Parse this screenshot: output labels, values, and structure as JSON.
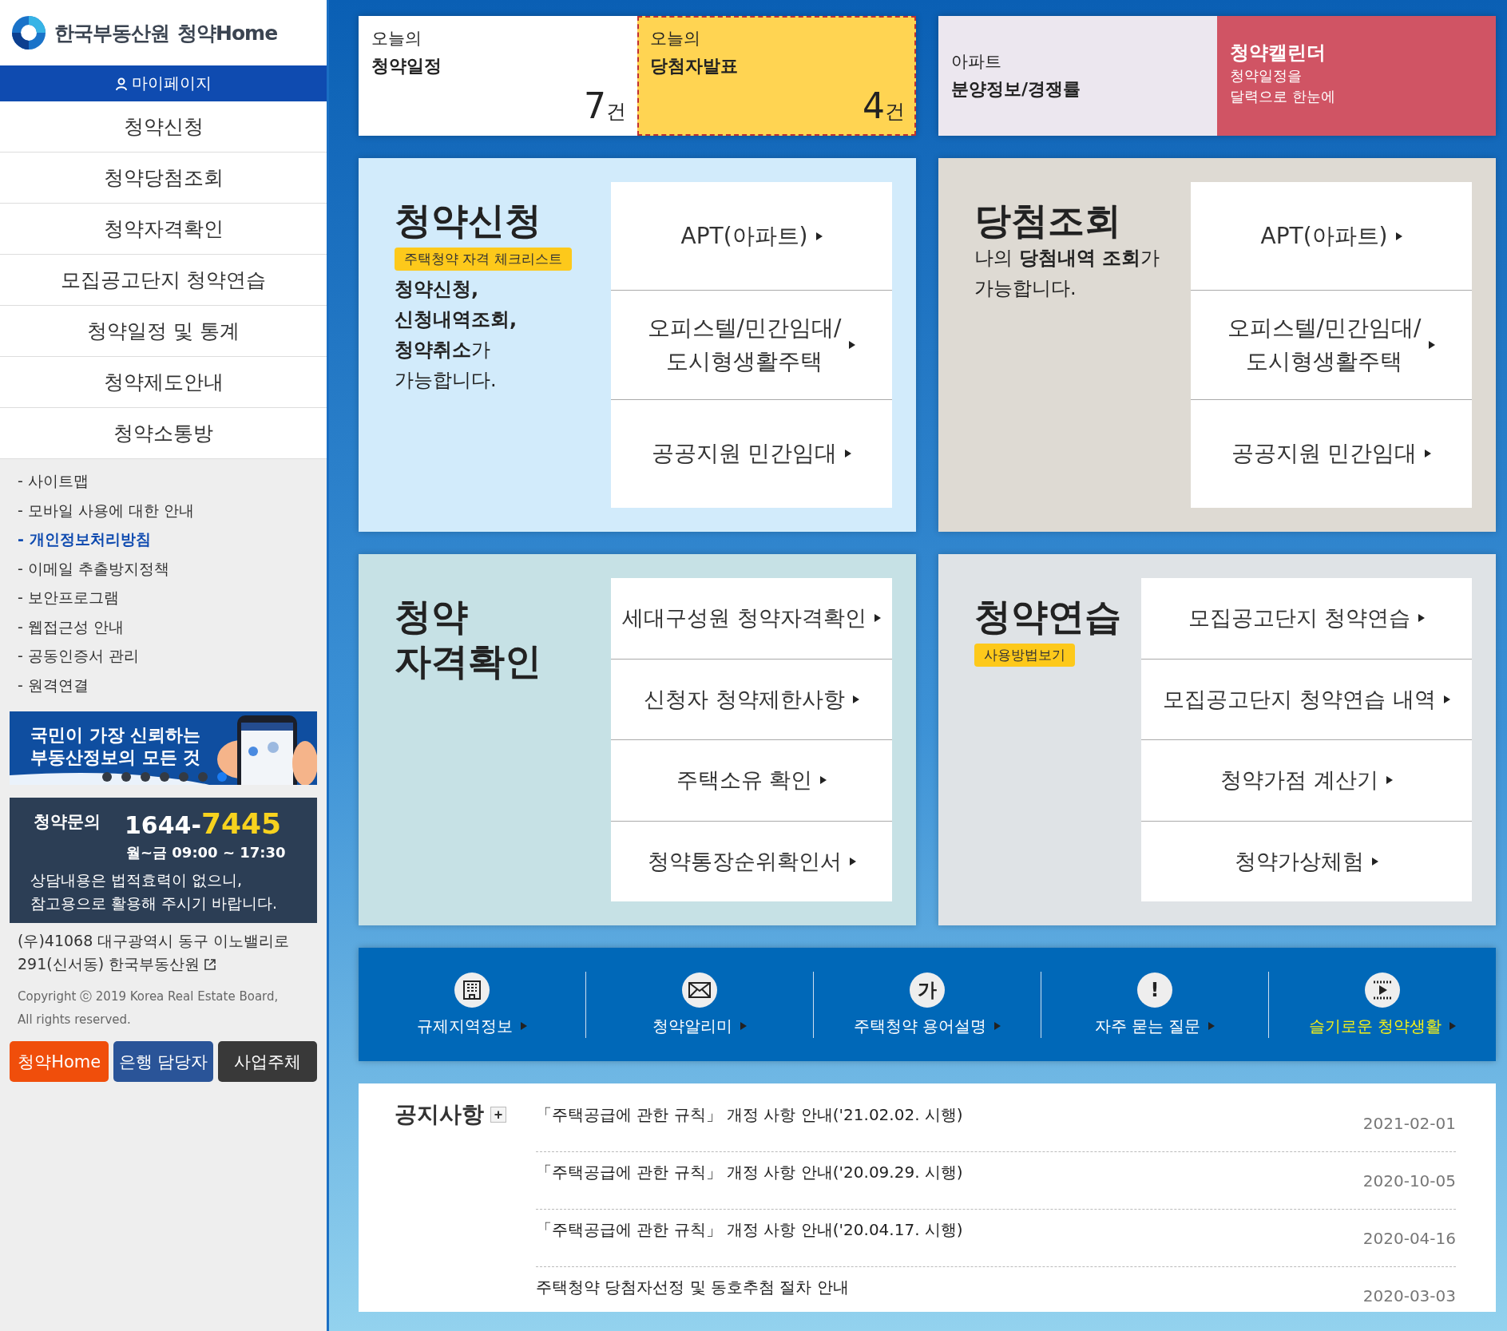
{
  "logo": {
    "org": "한국부동산원",
    "service": "청약Home"
  },
  "mypage": "마이페이지",
  "menu": [
    "청약신청",
    "청약당첨조회",
    "청약자격확인",
    "모집공고단지 청약연습",
    "청약일정 및 통계",
    "청약제도안내",
    "청약소통방"
  ],
  "footer_links": [
    {
      "label": "- 사이트맵",
      "highlighted": false
    },
    {
      "label": "- 모바일 사용에 대한 안내",
      "highlighted": false
    },
    {
      "label": "- 개인정보처리방침",
      "highlighted": true
    },
    {
      "label": "- 이메일 추출방지정책",
      "highlighted": false
    },
    {
      "label": "- 보안프로그램",
      "highlighted": false
    },
    {
      "label": "- 웹접근성 안내",
      "highlighted": false
    },
    {
      "label": "- 공동인증서 관리",
      "highlighted": false
    },
    {
      "label": "- 원격연결",
      "highlighted": false
    }
  ],
  "banner": {
    "lines": [
      "국민이 가장 신뢰하는",
      "부동산정보의 모든 것"
    ],
    "slides": [
      {
        "selected": false
      },
      {
        "selected": false
      },
      {
        "selected": false
      },
      {
        "selected": false
      },
      {
        "selected": false
      },
      {
        "selected": false
      },
      {
        "selected": true
      }
    ]
  },
  "inquiry": {
    "label": "청약문의",
    "phone_prefix": "1644-",
    "phone_suffix": "7445",
    "hours": "월~금 09:00 ~ 17:30",
    "note": [
      "상담내용은 법적효력이 없으니,",
      "참고용으로 활용해 주시기 바랍니다."
    ]
  },
  "address": [
    "(우)41068 대구광역시 동구 이노밸리로",
    "291(신서동) 한국부동산원"
  ],
  "copyright": [
    "Copyright ⓒ 2019 Korea Real Estate Board,",
    "All rights reserved."
  ],
  "site_buttons": [
    {
      "label": "청약Home",
      "color": "#f04e0b"
    },
    {
      "label": "은행 담당자",
      "color": "#2a5498"
    },
    {
      "label": "사업주체",
      "color": "#393939"
    }
  ],
  "top_tiles": [
    {
      "kicker": "오늘의",
      "title": "청약일정",
      "count": "7",
      "unit": "건",
      "color": "#ffffff",
      "focused": false,
      "kind": "count"
    },
    {
      "kicker": "오늘의",
      "title": "당첨자발표",
      "count": "4",
      "unit": "건",
      "color": "#ffd452",
      "focused": true,
      "kind": "count"
    },
    {
      "kicker": "아파트",
      "title": "분양정보/경쟁률",
      "color": "#ece7ef",
      "focused": false,
      "kind": "plain"
    },
    {
      "title": "청약캘린더",
      "lines": [
        "청약일정을",
        "달력으로 한눈에"
      ],
      "color": "#d05464",
      "focused": false,
      "kind": "promo"
    }
  ],
  "cards": [
    {
      "title": [
        "청약신청"
      ],
      "tag": "주택청약 자격 체크리스트",
      "description": [
        "**청약신청,**",
        "**신청내역조회,**",
        "**청약취소**가",
        "가능합니다."
      ],
      "color": "#d2ebfb",
      "links": [
        [
          "APT(아파트)"
        ],
        [
          "오피스텔/민간임대/",
          "도시형생활주택"
        ],
        [
          "공공지원 민간임대"
        ]
      ]
    },
    {
      "title": [
        "당첨조회"
      ],
      "description": [
        "나의 **당첨내역 조회**가",
        "가능합니다."
      ],
      "color": "#dedad3",
      "links": [
        [
          "APT(아파트)"
        ],
        [
          "오피스텔/민간임대/",
          "도시형생활주택"
        ],
        [
          "공공지원 민간임대"
        ]
      ]
    },
    {
      "title": [
        "청약",
        "자격확인"
      ],
      "color": "#c6e1e5",
      "links": [
        [
          "세대구성원 청약자격확인"
        ],
        [
          "신청자 청약제한사항"
        ],
        [
          "주택소유 확인"
        ],
        [
          "청약통장순위확인서"
        ]
      ]
    },
    {
      "title": [
        "청약연습"
      ],
      "tag": "사용방법보기",
      "color": "#dfe3e6",
      "links": [
        [
          "모집공고단지 청약연습"
        ],
        [
          "모집공고단지 청약연습 내역"
        ],
        [
          "청약가점 계산기"
        ],
        [
          "청약가상체험"
        ]
      ]
    }
  ],
  "quick_links": [
    {
      "label": "규제지역정보",
      "kind": "building",
      "highlighted": false
    },
    {
      "label": "청약알리미",
      "kind": "mail",
      "highlighted": false
    },
    {
      "label": "주택청약 용어설명",
      "kind": "glyph",
      "glyph": "가",
      "highlighted": false
    },
    {
      "label": "자주 묻는 질문",
      "kind": "glyph",
      "glyph": "!",
      "highlighted": false
    },
    {
      "label": "슬기로운 청약생활",
      "kind": "video",
      "highlighted": true
    }
  ],
  "notices": {
    "title": "공지사항",
    "more": "+",
    "items": [
      {
        "title": "「주택공급에 관한 규칙」 개정 사항 안내('21.02.02. 시행)",
        "date": "2021-02-01"
      },
      {
        "title": "「주택공급에 관한 규칙」 개정 사항 안내('20.09.29. 시행)",
        "date": "2020-10-05"
      },
      {
        "title": "「주택공급에 관한 규칙」 개정 사항 안내('20.04.17. 시행)",
        "date": "2020-04-16"
      },
      {
        "title": "주택청약 당첨자선정 및 동호추첨 절차 안내",
        "date": "2020-03-03"
      }
    ]
  }
}
